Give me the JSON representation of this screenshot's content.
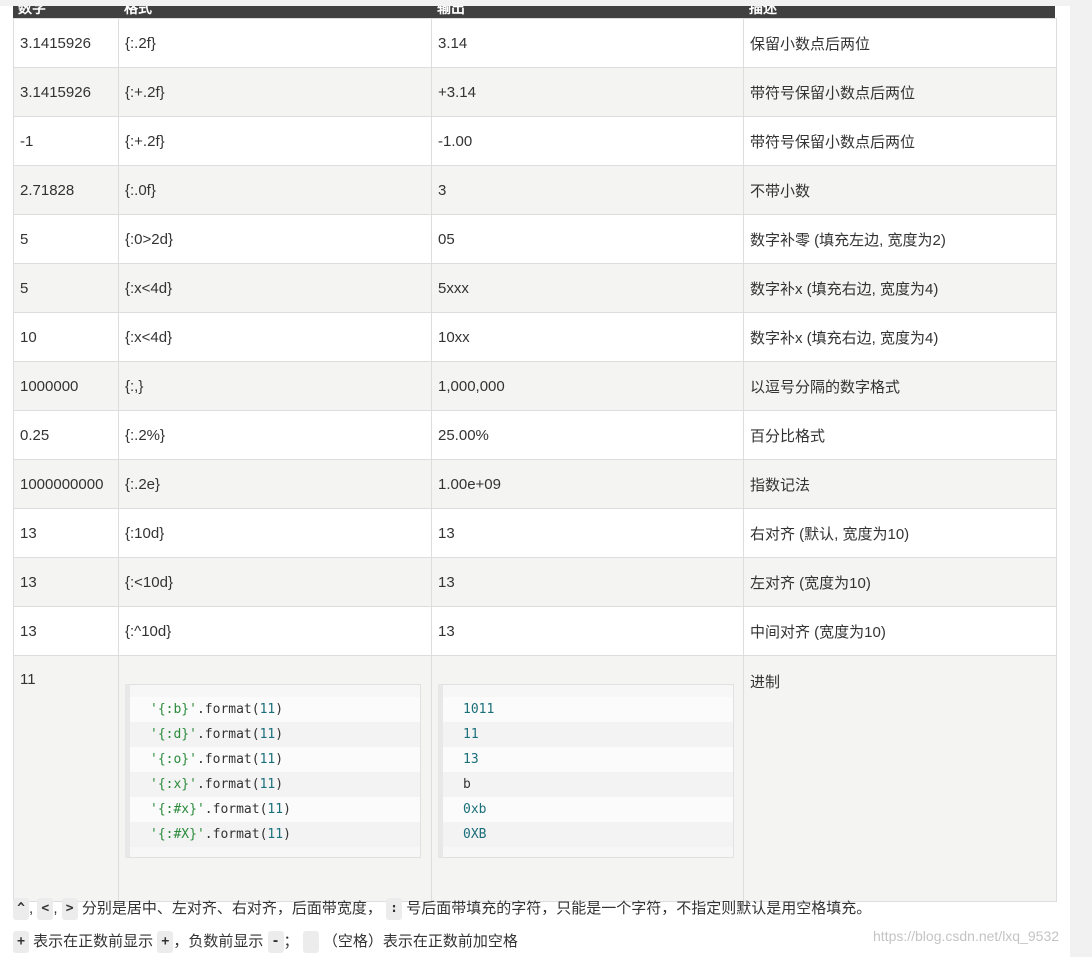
{
  "header": {
    "col1": "数字",
    "col2": "格式",
    "col3": "输出",
    "col4": "描述"
  },
  "rows": [
    {
      "num": "3.1415926",
      "fmt": "{:.2f}",
      "out": "3.14",
      "desc": "保留小数点后两位"
    },
    {
      "num": "3.1415926",
      "fmt": "{:+.2f}",
      "out": "+3.14",
      "desc": "带符号保留小数点后两位"
    },
    {
      "num": "-1",
      "fmt": "{:+.2f}",
      "out": "-1.00",
      "desc": "带符号保留小数点后两位"
    },
    {
      "num": "2.71828",
      "fmt": "{:.0f}",
      "out": "3",
      "desc": "不带小数"
    },
    {
      "num": "5",
      "fmt": "{:0>2d}",
      "out": "05",
      "desc": "数字补零 (填充左边, 宽度为2)"
    },
    {
      "num": "5",
      "fmt": "{:x<4d}",
      "out": "5xxx",
      "desc": "数字补x (填充右边, 宽度为4)"
    },
    {
      "num": "10",
      "fmt": "{:x<4d}",
      "out": "10xx",
      "desc": "数字补x (填充右边, 宽度为4)"
    },
    {
      "num": "1000000",
      "fmt": "{:,}",
      "out": "1,000,000",
      "desc": "以逗号分隔的数字格式"
    },
    {
      "num": "0.25",
      "fmt": "{:.2%}",
      "out": "25.00%",
      "desc": "百分比格式"
    },
    {
      "num": "1000000000",
      "fmt": "{:.2e}",
      "out": "1.00e+09",
      "desc": "指数记法"
    },
    {
      "num": "13",
      "fmt": "{:10d}",
      "out": "        13",
      "desc": "右对齐 (默认, 宽度为10)"
    },
    {
      "num": "13",
      "fmt": "{:<10d}",
      "out": "13",
      "desc": "左对齐 (宽度为10)"
    },
    {
      "num": "13",
      "fmt": "{:^10d}",
      "out": "    13",
      "desc": "中间对齐 (宽度为10)"
    }
  ],
  "base_row": {
    "num": "11",
    "desc": "进制",
    "code": [
      {
        "str": "'{:b}'",
        "method": ".format(",
        "arg": "11",
        "close": ")"
      },
      {
        "str": "'{:d}'",
        "method": ".format(",
        "arg": "11",
        "close": ")"
      },
      {
        "str": "'{:o}'",
        "method": ".format(",
        "arg": "11",
        "close": ")"
      },
      {
        "str": "'{:x}'",
        "method": ".format(",
        "arg": "11",
        "close": ")"
      },
      {
        "str": "'{:#x}'",
        "method": ".format(",
        "arg": "11",
        "close": ")"
      },
      {
        "str": "'{:#X}'",
        "method": ".format(",
        "arg": "11",
        "close": ")"
      }
    ],
    "output": [
      "1011",
      "11",
      "13",
      "b",
      "0xb",
      "0XB"
    ]
  },
  "notes": {
    "line1": {
      "k1": "^",
      "sep1": ", ",
      "k2": "<",
      "sep2": ", ",
      "k3": ">",
      "text1": " 分别是居中、左对齐、右对齐，后面带宽度， ",
      "k4": ":",
      "text2": " 号后面带填充的字符，只能是一个字符，不指定则默认是用空格填充。"
    },
    "line2": {
      "k1": "+",
      "text1": " 表示在正数前显示 ",
      "k2": "+",
      "text2": "，负数前显示 ",
      "k3": "-",
      "text3": "； ",
      "k4": " ",
      "text4": " （空格）表示在正数前加空格"
    }
  },
  "watermark": "https://blog.csdn.net/lxq_9532"
}
